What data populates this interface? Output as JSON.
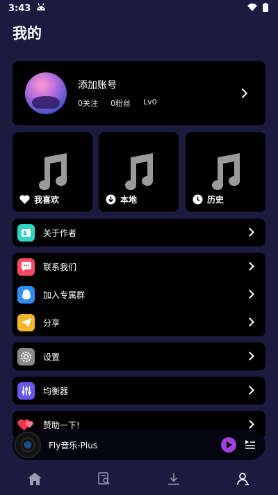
{
  "status": {
    "time": "3:43"
  },
  "header": {
    "title": "我的"
  },
  "profile": {
    "name": "添加账号",
    "following": "0关注",
    "fans": "0粉丝",
    "level": "Lv0"
  },
  "tiles": [
    {
      "label": "我喜欢",
      "icon": "heart-icon"
    },
    {
      "label": "本地",
      "icon": "download-icon"
    },
    {
      "label": "历史",
      "icon": "clock-icon"
    }
  ],
  "menu": {
    "about": {
      "label": "关于作者",
      "icon": "person-card-icon",
      "color": "#2fd6c4"
    },
    "contact": {
      "label": "联系我们",
      "icon": "chat-icon",
      "color": "#f24b63"
    },
    "group": {
      "label": "加入专属群",
      "icon": "qq-icon",
      "color": "#2f8cf2"
    },
    "share": {
      "label": "分享",
      "icon": "send-icon",
      "color": "#f7b52b"
    },
    "settings": {
      "label": "设置",
      "icon": "gear-icon",
      "color": "#8a8a8a"
    },
    "equalizer": {
      "label": "均衡器",
      "icon": "equalizer-icon",
      "color": "#6a57e8"
    },
    "donate": {
      "label": "赞助一下!",
      "icon": "hearts-icon",
      "color": "#f2364e"
    }
  },
  "player": {
    "song": "Fly音乐-Plus"
  },
  "nav": [
    "home-icon",
    "search-list-icon",
    "download-icon",
    "profile-icon"
  ],
  "colors": {
    "background": "#1d1a40",
    "card": "#000000",
    "accent": "#a040e0"
  }
}
